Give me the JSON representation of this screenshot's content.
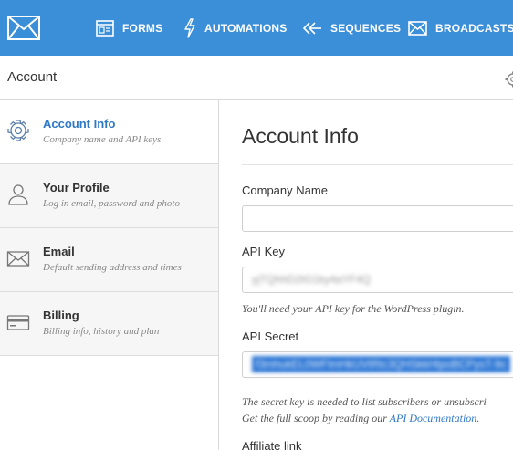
{
  "topnav": {
    "items": [
      {
        "label": "FORMS",
        "icon": "form-icon"
      },
      {
        "label": "AUTOMATIONS",
        "icon": "lightning-icon"
      },
      {
        "label": "SEQUENCES",
        "icon": "sequence-arrows-icon"
      },
      {
        "label": "BROADCASTS",
        "icon": "envelope-icon"
      }
    ]
  },
  "account_bar": {
    "title": "Account"
  },
  "sidebar": {
    "items": [
      {
        "title": "Account Info",
        "subtitle": "Company name and API keys",
        "icon": "gear-icon",
        "active": true
      },
      {
        "title": "Your Profile",
        "subtitle": "Log in email, password and photo",
        "icon": "user-icon",
        "active": false
      },
      {
        "title": "Email",
        "subtitle": "Default sending address and times",
        "icon": "envelope-icon",
        "active": false
      },
      {
        "title": "Billing",
        "subtitle": "Billing info, history and plan",
        "icon": "credit-card-icon",
        "active": false
      }
    ]
  },
  "main": {
    "title": "Account Info",
    "company_name": {
      "label": "Company Name",
      "value": ""
    },
    "api_key": {
      "label": "API Key",
      "value": "yjTQhhD2tG1ky4aYF4Q",
      "help": "You'll need your API key for the WordPress plugin."
    },
    "api_secret": {
      "label": "API Secret",
      "value": "f3mhukEL0WFlmHkUVtRtc3QHSkkHtpoBCPysT-9c",
      "help_line1": "The secret key is needed to list subscribers or unsubscri",
      "help_line2_prefix": "Get the full scoop by reading our ",
      "help_link": "API Documentation",
      "help_line2_suffix": "."
    },
    "affiliate": {
      "label": "Affiliate link"
    }
  },
  "colors": {
    "topbar": "#3b8ed8",
    "accent": "#2f78c4",
    "sidebar_bg": "#f6f6f6"
  }
}
